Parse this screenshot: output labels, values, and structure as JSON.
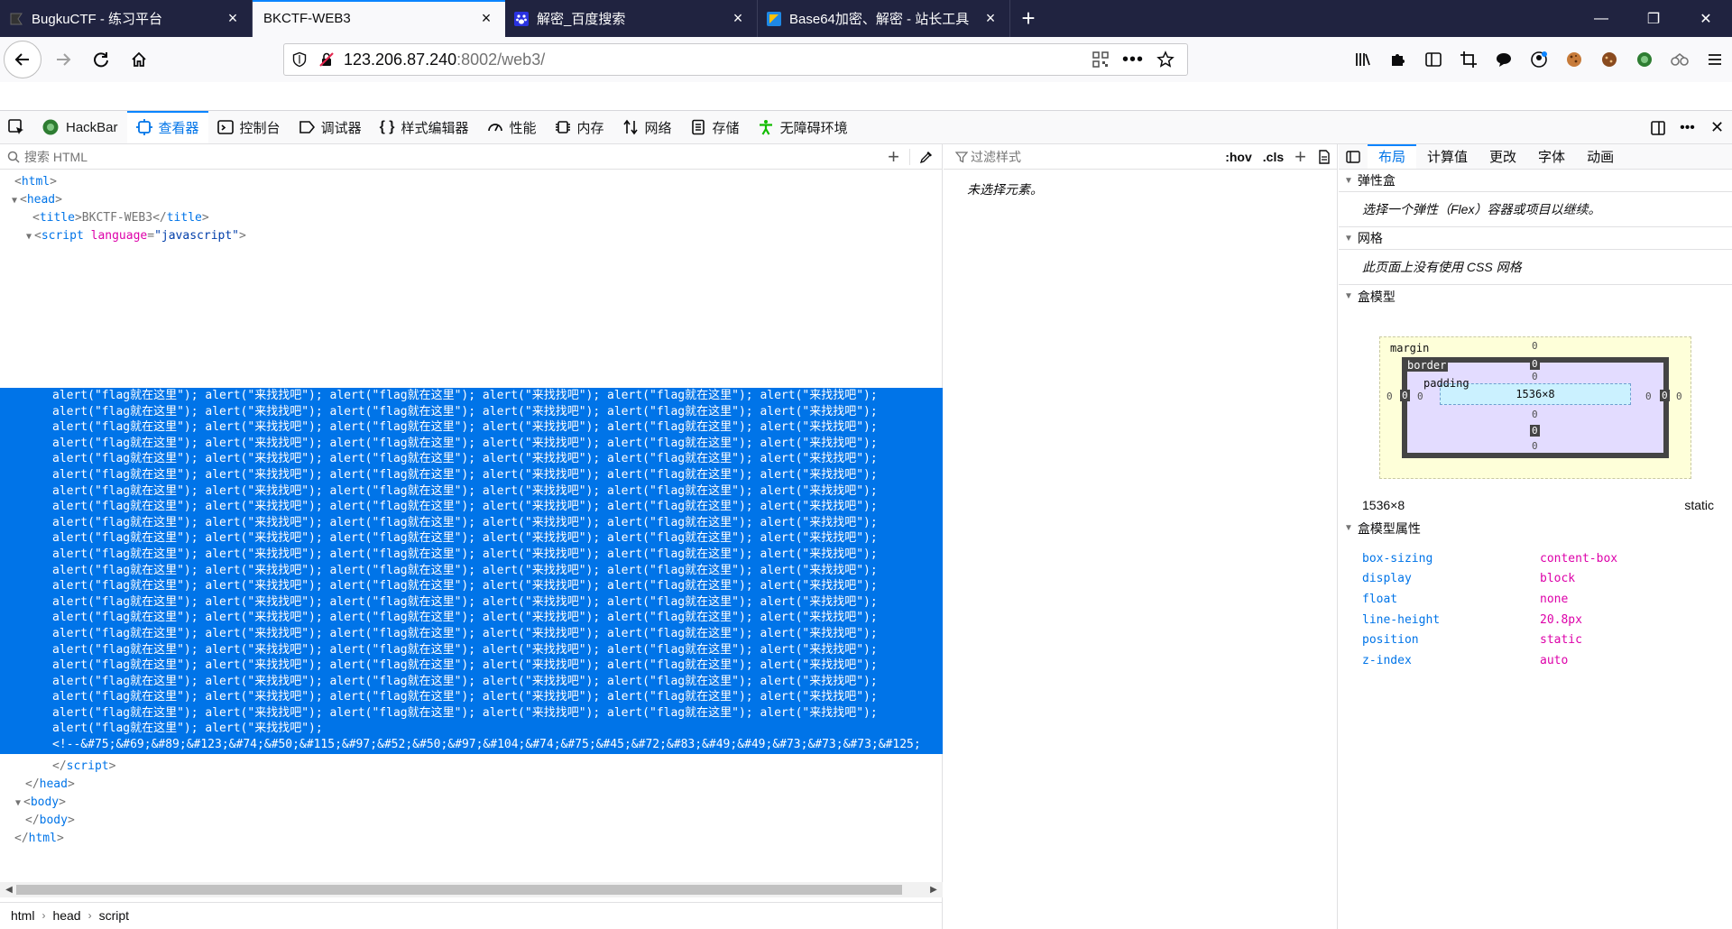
{
  "tabs": [
    {
      "title": "BugkuCTF - 练习平台",
      "active": false,
      "icon": "bugku-favicon",
      "color": "#3a3a3a"
    },
    {
      "title": "BKCTF-WEB3",
      "active": true,
      "icon": "none",
      "color": ""
    },
    {
      "title": "解密_百度搜索",
      "active": false,
      "icon": "baidu-paw-icon",
      "color": "#2932e1"
    },
    {
      "title": "Base64加密、解密 - 站长工具",
      "active": false,
      "icon": "chinaz-icon",
      "color": "#1e88e5"
    }
  ],
  "window": {
    "minimize": "—",
    "restore": "❐",
    "close": "✕"
  },
  "nav": {
    "url_host": "123.206.87.240",
    "url_port_path": ":8002/web3/"
  },
  "devtools": {
    "tabs": [
      {
        "label": "HackBar",
        "icon": "hackbar-icon"
      },
      {
        "label": "查看器",
        "icon": "inspector-icon",
        "active": true
      },
      {
        "label": "控制台",
        "icon": "console-icon"
      },
      {
        "label": "调试器",
        "icon": "debugger-icon"
      },
      {
        "label": "样式编辑器",
        "icon": "style-editor-icon"
      },
      {
        "label": "性能",
        "icon": "performance-icon"
      },
      {
        "label": "内存",
        "icon": "memory-icon"
      },
      {
        "label": "网络",
        "icon": "network-icon"
      },
      {
        "label": "存储",
        "icon": "storage-icon"
      },
      {
        "label": "无障碍环境",
        "icon": "accessibility-icon"
      }
    ]
  },
  "markup": {
    "search_placeholder": "搜索 HTML",
    "lines": {
      "html_open": "html",
      "head_open": "head",
      "title_tag": "title",
      "title_text": "BKCTF-WEB3",
      "script_tag": "script",
      "script_attr_name": "language",
      "script_attr_value": "\"javascript\"",
      "head_close": "head",
      "body_open": "body",
      "body_close": "body",
      "html_close": "html",
      "script_close": "script"
    },
    "alert_a": "alert(\"flag就在这里\");",
    "alert_b": "alert(\"来找找吧\");",
    "alert_rows": 21,
    "comment_line": "<!--&#75;&#69;&#89;&#123;&#74;&#50;&#115;&#97;&#52;&#50;&#97;&#104;&#74;&#75;&#45;&#72;&#83;&#49;&#49;&#73;&#73;&#73;&#125;",
    "breadcrumbs": [
      "html",
      "head",
      "script"
    ]
  },
  "rules": {
    "filter_placeholder": "过滤样式",
    "hov": ":hov",
    "cls": ".cls",
    "empty_text": "未选择元素。"
  },
  "layout": {
    "tabs": [
      "布局",
      "计算值",
      "更改",
      "字体",
      "动画"
    ],
    "flexbox": {
      "title": "弹性盒",
      "text": "选择一个弹性（Flex）容器或项目以继续。"
    },
    "grid": {
      "title": "网格",
      "text": "此页面上没有使用 CSS 网格"
    },
    "boxmodel": {
      "title": "盒模型",
      "margin_label": "margin",
      "border_label": "border",
      "padding_label": "padding",
      "content": "1536×8",
      "zero": "0"
    },
    "dimensions": "1536×8",
    "position_value": "static",
    "props_title": "盒模型属性",
    "props": [
      {
        "name": "box-sizing",
        "value": "content-box"
      },
      {
        "name": "display",
        "value": "block"
      },
      {
        "name": "float",
        "value": "none"
      },
      {
        "name": "line-height",
        "value": "20.8px"
      },
      {
        "name": "position",
        "value": "static"
      },
      {
        "name": "z-index",
        "value": "auto"
      }
    ]
  }
}
